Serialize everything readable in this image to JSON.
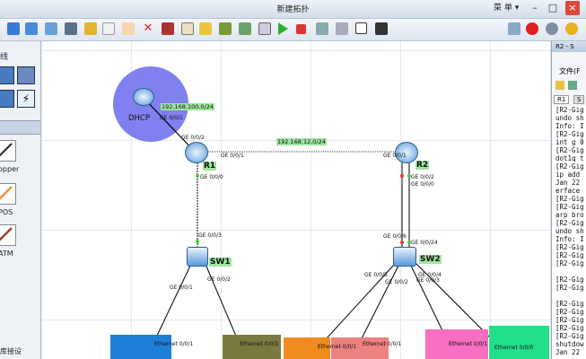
{
  "window": {
    "title": "新建拓扑",
    "menu_label": "菜 单",
    "menu_arrow": "▾",
    "minimize": "–",
    "maximize": "□",
    "close": "×"
  },
  "toolbar": {
    "icons": [
      "new-topology-icon",
      "save-icon",
      "save-as-icon",
      "print-icon",
      "undo-icon",
      "redo-icon",
      "select-icon",
      "pan-icon",
      "delete-icon",
      "delete-link-icon",
      "text-note-icon",
      "rectangle-icon",
      "custom-icon",
      "zoom-icon",
      "capture-icon",
      "palette-icon",
      "start-device-icon",
      "stop-device-icon",
      "capture-data-icon",
      "fullscreen-icon",
      "snapshot-icon",
      "console-icon",
      "huawei-icon",
      "settings-icon",
      "help-icon"
    ]
  },
  "left_panel": {
    "top_label": "线",
    "cables": [
      {
        "label": "opper"
      },
      {
        "label": "POS"
      },
      {
        "label": "ATM"
      }
    ],
    "bottom_label": "库接设"
  },
  "right_panel": {
    "title": "R2 - S",
    "menu": "文件(F",
    "tabs": [
      "R1",
      "S"
    ],
    "cli_lines": [
      "[R2-Gig",
      "undo sh",
      "Info: I",
      "[R2-Gig",
      "int g 0",
      "[R2-Gig",
      "dot1q t",
      "[R2-Gig",
      "ip add ",
      "Jan 22 ",
      "erface ",
      "[R2-Gig",
      "[R2-Gig",
      "arp bro",
      "[R2-Gig",
      "undo sh",
      "Info: I",
      "[R2-Gig",
      "[R2-Gig",
      "[R2-Gig",
      "",
      "[R2-Gig",
      "[R2-Gig",
      "",
      "[R2-Gig",
      "[R2-Gig",
      "[R2-Gig",
      "[R2-Gig",
      "[R2-Gig",
      "shutdow",
      "Jan 22 "
    ]
  },
  "topology": {
    "dhcp": {
      "name": "DHCP",
      "subnet": "192.168.100.0/24",
      "port": "GE 0/0/1"
    },
    "r1": {
      "name": "R1",
      "ports": {
        "to_dhcp": "GE 0/0/2",
        "to_r2": "GE 0/0/1",
        "to_sw1": "GE 0/0/0"
      }
    },
    "r2": {
      "name": "R2",
      "ports": {
        "to_r1": "GE 0/0/1",
        "to_sw2_a": "GE 0/0/2",
        "to_sw2_b": "GE 0/0/0"
      }
    },
    "link_r1_r2": "192.168.12.0/24",
    "sw1": {
      "name": "SW1",
      "ports": {
        "up": "GE 0/0/3",
        "left": "GE 0/0/1",
        "right": "GE 0/0/2"
      }
    },
    "sw2": {
      "name": "SW2",
      "ports": {
        "up_a": "GE 0/0/6",
        "up_b": "GE 0/0/24",
        "p5": "GE 0/0/5",
        "p2": "GE 0/0/2",
        "p4": "GE 0/0/4",
        "p3": "GE 0/0/3"
      }
    },
    "pc_ports": {
      "blue": "Ethernet 0/0/1",
      "olive": "Ethernet 0/0/1",
      "orange": "Ethernet 0/0/1",
      "red": "Ethernet 0/0/1",
      "pink": "Ethernet 0/0/1",
      "green": "Ethernet 0/0/0"
    },
    "vlan_colors": {
      "blue": "#1e7fd8",
      "olive": "#7b7a3e",
      "orange": "#f08c1e",
      "red": "#ee8080",
      "pink": "#f66fc0",
      "green": "#22e08a",
      "dhcp_zone": "#8080f0"
    }
  }
}
